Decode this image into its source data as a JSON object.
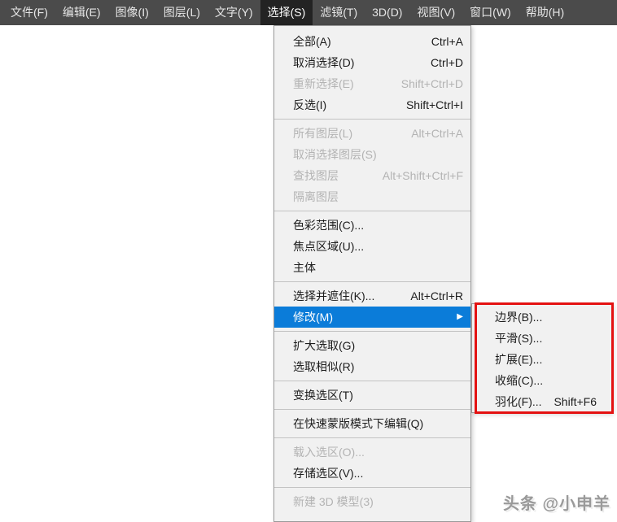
{
  "colors": {
    "menubar_bg": "#4b4b4b",
    "menubar_selected_bg": "#232323",
    "panel_bg": "#f1f1f1",
    "panel_border": "#9a9a9a",
    "text": "#1c1c1c",
    "disabled_text": "#b3b3b3",
    "highlight_blue": "#0b7cd9",
    "annotation_red": "#e41212"
  },
  "icons": {
    "submenu_arrow": "▶"
  },
  "menu_bar": {
    "items": [
      {
        "label": "文件(F)"
      },
      {
        "label": "编辑(E)"
      },
      {
        "label": "图像(I)"
      },
      {
        "label": "图层(L)"
      },
      {
        "label": "文字(Y)"
      },
      {
        "label": "选择(S)",
        "selected": true
      },
      {
        "label": "滤镜(T)"
      },
      {
        "label": "3D(D)"
      },
      {
        "label": "视图(V)"
      },
      {
        "label": "窗口(W)"
      },
      {
        "label": "帮助(H)"
      }
    ]
  },
  "select_menu": {
    "groups": [
      {
        "items": [
          {
            "label": "全部(A)",
            "shortcut": "Ctrl+A"
          },
          {
            "label": "取消选择(D)",
            "shortcut": "Ctrl+D"
          },
          {
            "label": "重新选择(E)",
            "shortcut": "Shift+Ctrl+D",
            "disabled": true
          },
          {
            "label": "反选(I)",
            "shortcut": "Shift+Ctrl+I"
          }
        ]
      },
      {
        "items": [
          {
            "label": "所有图层(L)",
            "shortcut": "Alt+Ctrl+A",
            "disabled": true
          },
          {
            "label": "取消选择图层(S)",
            "disabled": true
          },
          {
            "label": "查找图层",
            "shortcut": "Alt+Shift+Ctrl+F",
            "disabled": true
          },
          {
            "label": "隔离图层",
            "disabled": true
          }
        ]
      },
      {
        "items": [
          {
            "label": "色彩范围(C)..."
          },
          {
            "label": "焦点区域(U)..."
          },
          {
            "label": "主体"
          }
        ]
      },
      {
        "items": [
          {
            "label": "选择并遮住(K)...",
            "shortcut": "Alt+Ctrl+R"
          },
          {
            "label": "修改(M)",
            "highlighted": true,
            "has_submenu": true
          }
        ]
      },
      {
        "items": [
          {
            "label": "扩大选取(G)"
          },
          {
            "label": "选取相似(R)"
          }
        ]
      },
      {
        "items": [
          {
            "label": "变换选区(T)"
          }
        ]
      },
      {
        "items": [
          {
            "label": "在快速蒙版模式下编辑(Q)"
          }
        ]
      },
      {
        "items": [
          {
            "label": "载入选区(O)...",
            "disabled": true
          },
          {
            "label": "存储选区(V)..."
          }
        ]
      },
      {
        "items": [
          {
            "label": "新建 3D 模型(3)",
            "disabled": true
          }
        ]
      }
    ]
  },
  "modify_submenu": {
    "items": [
      {
        "label": "边界(B)..."
      },
      {
        "label": "平滑(S)..."
      },
      {
        "label": "扩展(E)..."
      },
      {
        "label": "收缩(C)..."
      },
      {
        "label": "羽化(F)...",
        "shortcut": "Shift+F6"
      }
    ]
  },
  "watermark": {
    "text": "头条 @小申羊"
  }
}
